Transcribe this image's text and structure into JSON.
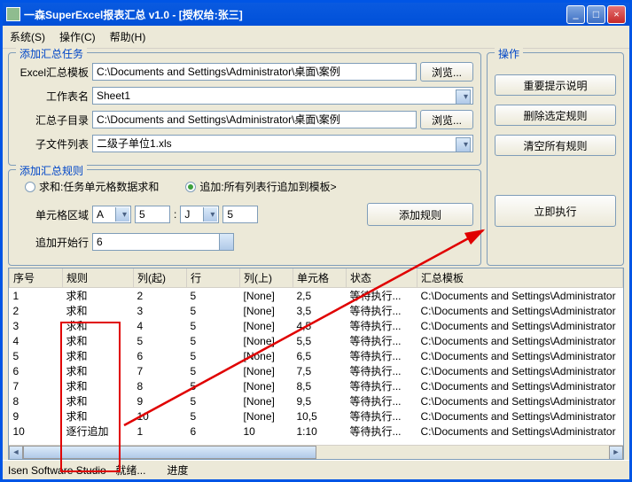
{
  "window": {
    "title": "一森SuperExcel报表汇总 v1.0 - [授权给:张三]"
  },
  "menu": {
    "system": "系统(S)",
    "operate": "操作(C)",
    "help": "帮助(H)"
  },
  "task_box": {
    "title": "添加汇总任务",
    "tpl_label": "Excel汇总模板",
    "tpl_value": "C:\\Documents and Settings\\Administrator\\桌面\\案例",
    "sheet_label": "工作表名",
    "sheet_value": "Sheet1",
    "dir_label": "汇总子目录",
    "dir_value": "C:\\Documents and Settings\\Administrator\\桌面\\案例",
    "file_label": "子文件列表",
    "file_value": "二级子单位1.xls",
    "browse": "浏览..."
  },
  "rule_box": {
    "title": "添加汇总规则",
    "radio1": "求和:任务单元格数据求和",
    "radio2": "追加:所有列表行追加到模板>",
    "range_label": "单元格区域",
    "col_from": "A",
    "row_from": "5",
    "col_to": "J",
    "row_to": "5",
    "start_label": "追加开始行",
    "start_value": "6",
    "add_rule": "添加规则"
  },
  "op_box": {
    "title": "操作",
    "btn1": "重要提示说明",
    "btn2": "删除选定规则",
    "btn3": "清空所有规则",
    "btn4": "立即执行"
  },
  "table": {
    "headers": {
      "no": "序号",
      "rule": "规则",
      "colf": "列(起)",
      "row": "行",
      "colt": "列(上)",
      "cell": "单元格",
      "status": "状态",
      "tpl": "汇总模板"
    },
    "rows": [
      {
        "no": "1",
        "rule": "求和",
        "colf": "2",
        "row": "5",
        "colt": "[None]",
        "cell": "2,5",
        "status": "等待执行...",
        "tpl": "C:\\Documents and Settings\\Administrator"
      },
      {
        "no": "2",
        "rule": "求和",
        "colf": "3",
        "row": "5",
        "colt": "[None]",
        "cell": "3,5",
        "status": "等待执行...",
        "tpl": "C:\\Documents and Settings\\Administrator"
      },
      {
        "no": "3",
        "rule": "求和",
        "colf": "4",
        "row": "5",
        "colt": "[None]",
        "cell": "4,5",
        "status": "等待执行...",
        "tpl": "C:\\Documents and Settings\\Administrator"
      },
      {
        "no": "4",
        "rule": "求和",
        "colf": "5",
        "row": "5",
        "colt": "[None]",
        "cell": "5,5",
        "status": "等待执行...",
        "tpl": "C:\\Documents and Settings\\Administrator"
      },
      {
        "no": "5",
        "rule": "求和",
        "colf": "6",
        "row": "5",
        "colt": "[None]",
        "cell": "6,5",
        "status": "等待执行...",
        "tpl": "C:\\Documents and Settings\\Administrator"
      },
      {
        "no": "6",
        "rule": "求和",
        "colf": "7",
        "row": "5",
        "colt": "[None]",
        "cell": "7,5",
        "status": "等待执行...",
        "tpl": "C:\\Documents and Settings\\Administrator"
      },
      {
        "no": "7",
        "rule": "求和",
        "colf": "8",
        "row": "5",
        "colt": "[None]",
        "cell": "8,5",
        "status": "等待执行...",
        "tpl": "C:\\Documents and Settings\\Administrator"
      },
      {
        "no": "8",
        "rule": "求和",
        "colf": "9",
        "row": "5",
        "colt": "[None]",
        "cell": "9,5",
        "status": "等待执行...",
        "tpl": "C:\\Documents and Settings\\Administrator"
      },
      {
        "no": "9",
        "rule": "求和",
        "colf": "10",
        "row": "5",
        "colt": "[None]",
        "cell": "10,5",
        "status": "等待执行...",
        "tpl": "C:\\Documents and Settings\\Administrator"
      },
      {
        "no": "10",
        "rule": "逐行追加",
        "colf": "1",
        "row": "6",
        "colt": "10",
        "cell": "1:10",
        "status": "等待执行...",
        "tpl": "C:\\Documents and Settings\\Administrator"
      }
    ]
  },
  "status": {
    "left": "Isen Software Studio - 就绪...",
    "progress": "进度"
  },
  "glyphs": {
    "min": "_",
    "max": "□",
    "close": "×"
  }
}
